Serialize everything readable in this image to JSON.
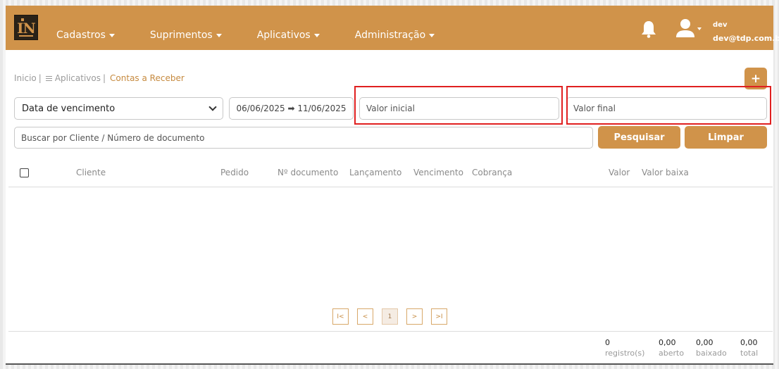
{
  "navbar": {
    "logo_text": "IN",
    "menu": [
      {
        "label": "Cadastros"
      },
      {
        "label": "Suprimentos"
      },
      {
        "label": "Aplicativos"
      },
      {
        "label": "Administração"
      }
    ],
    "user_name": "dev",
    "user_email": "dev@tdp.com.br"
  },
  "breadcrumb": {
    "home": "Inicio",
    "separator": "|",
    "apps": "Aplicativos",
    "current": "Contas a Receber"
  },
  "filters": {
    "add_label": "+",
    "date_field_selected": "Data de vencimento",
    "date_range": "06/06/2025 ➡ 11/06/2025",
    "valor_inicial_placeholder": "Valor inicial",
    "valor_final_placeholder": "Valor final",
    "search_placeholder": "Buscar por Cliente / Número de documento",
    "search_label": "Pesquisar",
    "clear_label": "Limpar"
  },
  "table": {
    "columns": [
      "Cliente",
      "Pedido",
      "Nº documento",
      "Lançamento",
      "Vencimento",
      "Cobrança",
      "Valor",
      "Valor baixa"
    ]
  },
  "pager": {
    "first": "I<",
    "prev": "<",
    "page": "1",
    "next": ">",
    "last": ">I"
  },
  "summary": {
    "registros_value": "0",
    "registros_label": "registro(s)",
    "aberto_value": "0,00",
    "aberto_label": "aberto",
    "baixado_value": "0,00",
    "baixado_label": "baixado",
    "total_value": "0,00",
    "total_label": "total"
  },
  "colors": {
    "brand": "#d0934a",
    "highlight": "#e02020"
  }
}
